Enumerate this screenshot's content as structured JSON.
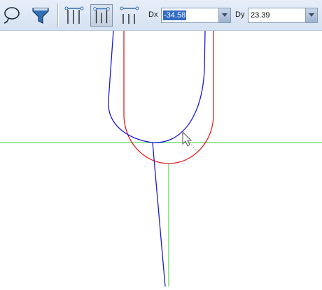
{
  "toolbar": {
    "buttons": [
      {
        "icon": "lasso-icon"
      },
      {
        "icon": "filter-funnel-icon"
      },
      {
        "icon": "vertical-lines-top-icon"
      },
      {
        "icon": "vertical-lines-bracket-icon",
        "active": true
      },
      {
        "icon": "vertical-lines-dashed-icon"
      }
    ],
    "dx": {
      "label": "Dx",
      "value": "-34.58"
    },
    "dy": {
      "label": "Dy",
      "value": "23.39"
    }
  },
  "colors": {
    "red_curve": "#e02020",
    "blue_curve": "#1a1ad0",
    "green_guide": "#33cc33",
    "toolbar_bg": "#dbe5f3",
    "selection": "#316ac5"
  }
}
